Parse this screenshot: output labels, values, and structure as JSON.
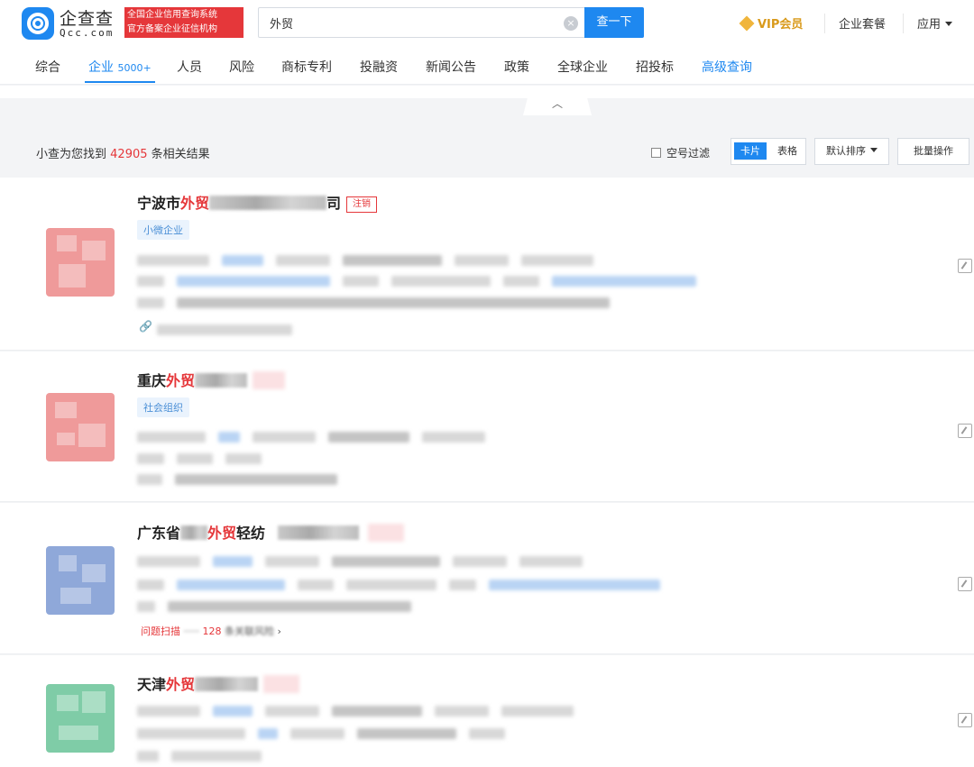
{
  "header": {
    "logo_cn": "企查查",
    "logo_en": "Qcc.com",
    "badge_line1": "全国企业信用查询系统",
    "badge_line2": "官方备案企业征信机构",
    "search_value": "外贸",
    "search_button": "查一下",
    "vip": "VIP会员",
    "package": "企业套餐",
    "apps": "应用"
  },
  "tabs": [
    {
      "label": "综合"
    },
    {
      "label": "企业",
      "count": "5000+"
    },
    {
      "label": "人员"
    },
    {
      "label": "风险"
    },
    {
      "label": "商标专利"
    },
    {
      "label": "投融资"
    },
    {
      "label": "新闻公告"
    },
    {
      "label": "政策"
    },
    {
      "label": "全球企业"
    },
    {
      "label": "招投标"
    },
    {
      "label": "高级查询"
    }
  ],
  "results": {
    "prefix": "小查为您找到",
    "count": "42905",
    "suffix": "条相关结果",
    "filter_empty": "空号过滤",
    "view_card": "卡片",
    "view_table": "表格",
    "sort": "默认排序",
    "bulk": "批量操作"
  },
  "cards": [
    {
      "prefix": "宁波市",
      "highlight": "外贸",
      "suffix": "司",
      "status": "注销",
      "type_tag": "小微企业"
    },
    {
      "prefix": "重庆",
      "highlight": "外贸",
      "suffix": "",
      "type_tag": "社会组织"
    },
    {
      "prefix": "广东省",
      "highlight": "外贸",
      "suffix": "轻纺",
      "risk_label": "问题扫描",
      "risk_count": "128",
      "risk_text": "条关联风险"
    },
    {
      "prefix": "天津",
      "highlight": "外贸",
      "suffix": ""
    }
  ],
  "colors": {
    "accent": "#1e88f0",
    "highlight": "#e5373a",
    "avatar1": "#ef9a9a",
    "avatar2": "#ef9a9a",
    "avatar3": "#8fa8d9",
    "avatar4": "#7fcca7"
  }
}
